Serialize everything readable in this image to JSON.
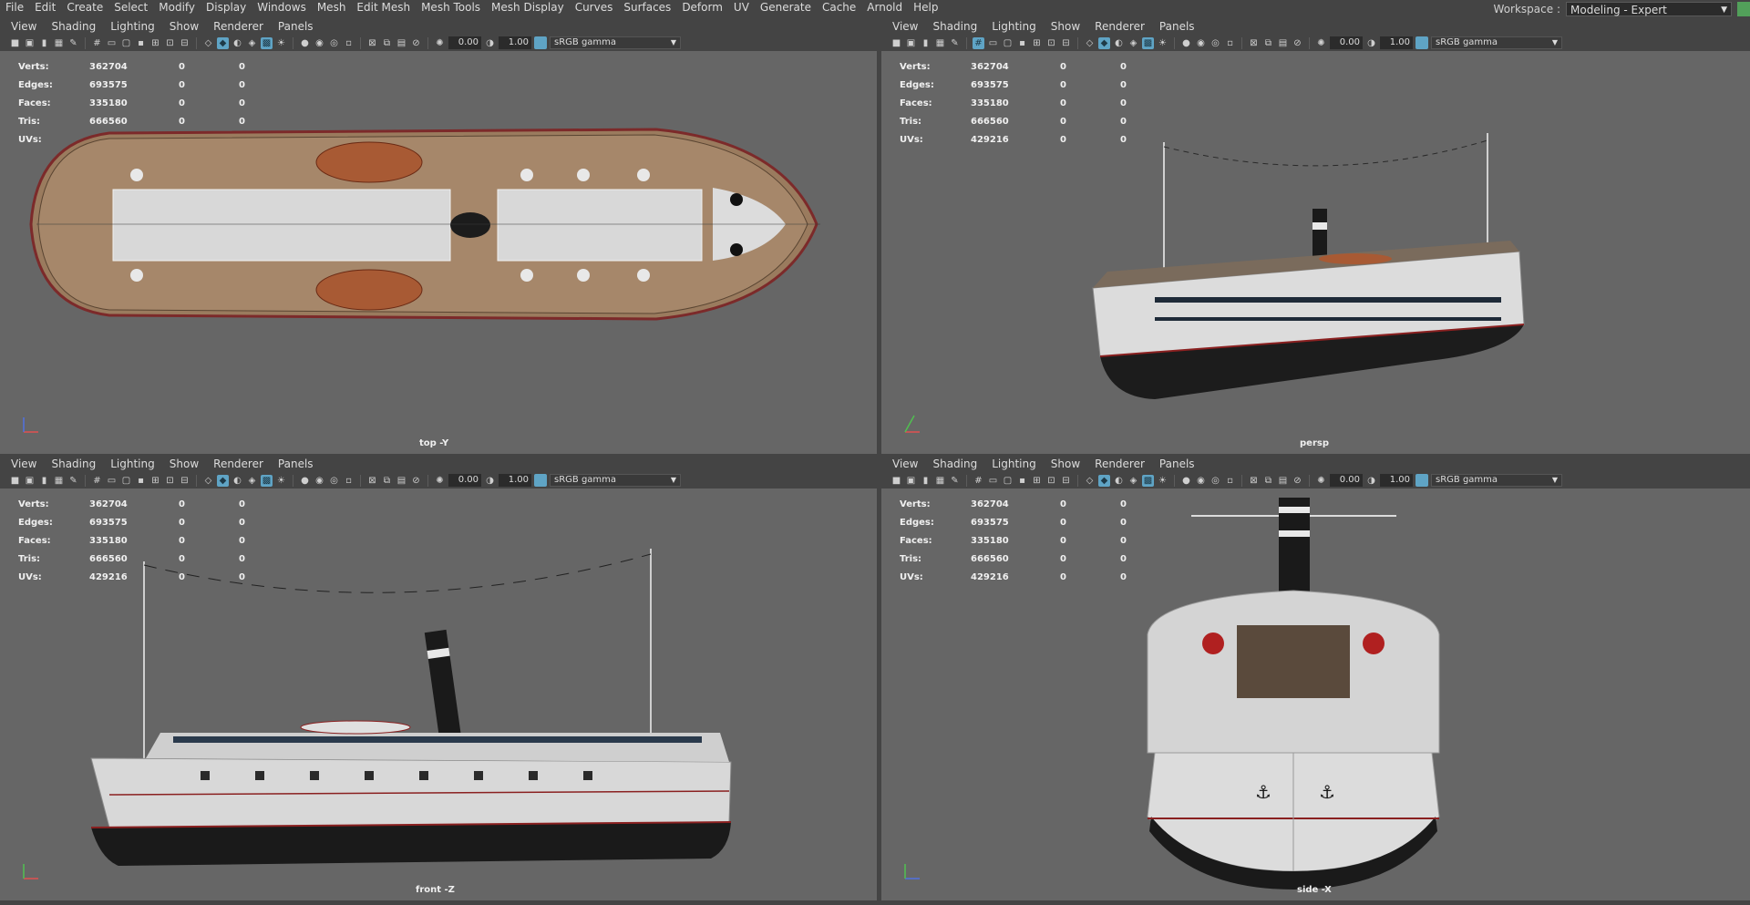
{
  "menubar": {
    "items": [
      "File",
      "Edit",
      "Create",
      "Select",
      "Modify",
      "Display",
      "Windows",
      "Mesh",
      "Edit Mesh",
      "Mesh Tools",
      "Mesh Display",
      "Curves",
      "Surfaces",
      "Deform",
      "UV",
      "Generate",
      "Cache",
      "Arnold",
      "Help"
    ],
    "workspace_label": "Workspace :",
    "workspace_value": "Modeling - Expert"
  },
  "panel_menu": [
    "View",
    "Shading",
    "Lighting",
    "Show",
    "Renderer",
    "Panels"
  ],
  "toolbar": {
    "exposure": "0.00",
    "gamma": "1.00",
    "color_space": "sRGB gamma"
  },
  "hud": {
    "rows": [
      {
        "label": "Verts:",
        "value": "362704",
        "sel": "0",
        "comp": "0"
      },
      {
        "label": "Edges:",
        "value": "693575",
        "sel": "0",
        "comp": "0"
      },
      {
        "label": "Faces:",
        "value": "335180",
        "sel": "0",
        "comp": "0"
      },
      {
        "label": "Tris:",
        "value": "666560",
        "sel": "0",
        "comp": "0"
      },
      {
        "label": "UVs:",
        "value": "429216",
        "sel": "0",
        "comp": "0"
      }
    ]
  },
  "viewports": {
    "top": {
      "camera": "top -Y"
    },
    "persp": {
      "camera": "persp"
    },
    "front": {
      "camera": "front -Z"
    },
    "side": {
      "camera": "side -X"
    }
  },
  "colors": {
    "viewport_bg": "#666666",
    "ui_bg": "#444444",
    "accent": "#5fa4c5"
  }
}
